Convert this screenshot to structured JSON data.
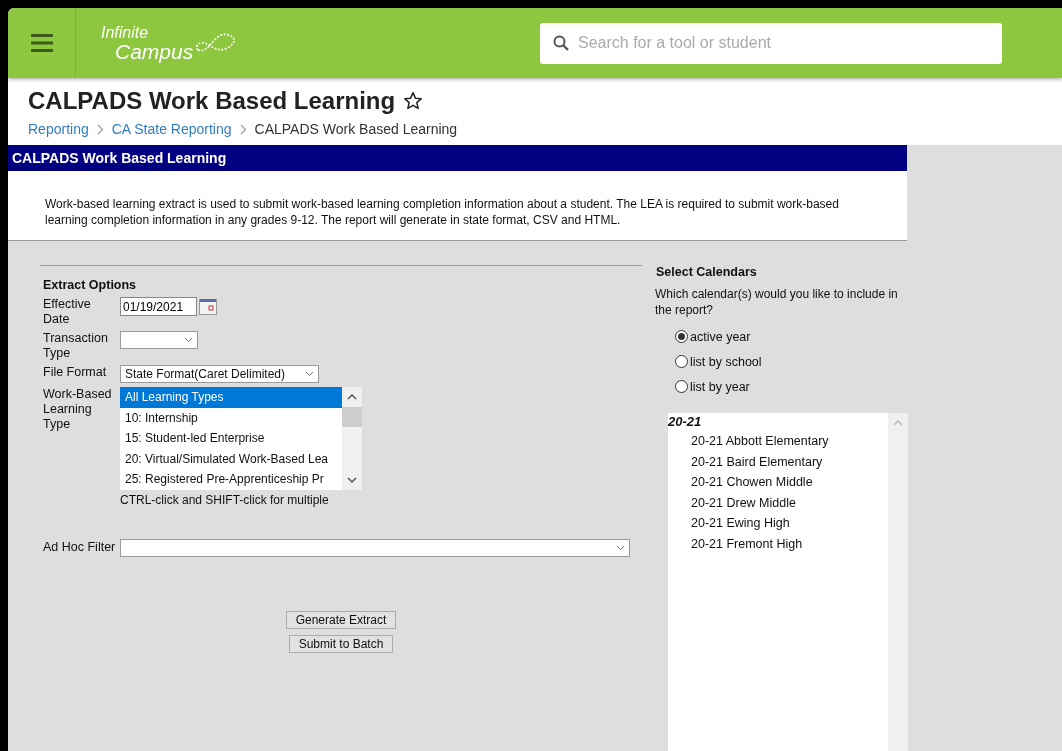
{
  "header": {
    "logo_line1": "Infinite",
    "logo_line2": "Campus",
    "search": {
      "placeholder": "Search for a tool or student"
    }
  },
  "page": {
    "title": "CALPADS Work Based Learning",
    "favorite": false,
    "breadcrumbs": [
      {
        "label": "Reporting",
        "link": true
      },
      {
        "label": "CA State Reporting",
        "link": true
      },
      {
        "label": "CALPADS Work Based Learning",
        "link": false
      }
    ]
  },
  "panel": {
    "title": "CALPADS Work Based Learning",
    "description": "Work-based learning extract is used to submit work-based learning completion information about a student. The LEA is required to submit work-based learning completion information in any grades 9-12. The report will generate in state format, CSV and HTML."
  },
  "extract_options": {
    "heading": "Extract Options",
    "effective_date": {
      "label": "Effective Date",
      "value": "01/19/2021"
    },
    "transaction_type": {
      "label": "Transaction Type"
    },
    "file_format": {
      "label": "File Format",
      "value": "State Format(Caret Delimited)"
    },
    "learning_type": {
      "label": "Work-Based Learning Type",
      "options": [
        {
          "label": "All Learning Types",
          "selected": true
        },
        {
          "label": "10: Internship",
          "selected": false
        },
        {
          "label": "15: Student-led Enterprise",
          "selected": false
        },
        {
          "label": "20: Virtual/Simulated Work-Based Lea",
          "selected": false
        },
        {
          "label": "25: Registered Pre-Apprenticeship Pr",
          "selected": false
        }
      ],
      "hint": "CTRL-click and SHIFT-click for multiple"
    },
    "ad_hoc_filter": {
      "label": "Ad Hoc Filter"
    }
  },
  "buttons": [
    "Generate Extract",
    "Submit to Batch"
  ],
  "calendars": {
    "heading": "Select Calendars",
    "question": "Which calendar(s) would you like to include in the report?",
    "modes": [
      {
        "label": "active year",
        "selected": true
      },
      {
        "label": "list by school",
        "selected": false
      },
      {
        "label": "list by year",
        "selected": false
      }
    ],
    "tree": [
      {
        "label": "20-21",
        "children": [
          {
            "label": "20-21 Abbott Elementary"
          },
          {
            "label": "20-21 Baird Elementary"
          },
          {
            "label": "20-21 Chowen Middle"
          },
          {
            "label": "20-21 Drew Middle"
          },
          {
            "label": "20-21 Ewing High"
          },
          {
            "label": "20-21 Fremont High"
          }
        ]
      }
    ]
  }
}
